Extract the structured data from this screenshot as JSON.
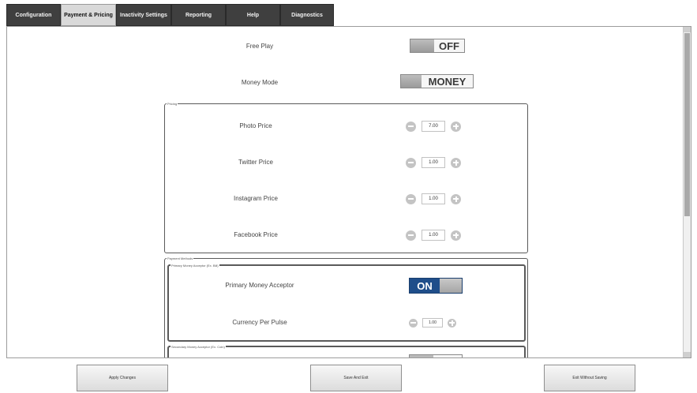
{
  "tabs": [
    {
      "label": "Configuration",
      "active": false
    },
    {
      "label": "Payment & Pricing",
      "active": true
    },
    {
      "label": "Inactivity Settings",
      "active": false
    },
    {
      "label": "Reporting",
      "active": false
    },
    {
      "label": "Help",
      "active": false
    },
    {
      "label": "Diagnostics",
      "active": false
    }
  ],
  "settings": {
    "free_play": {
      "label": "Free Play",
      "value": "OFF"
    },
    "money_mode": {
      "label": "Money Mode",
      "value": "MONEY"
    }
  },
  "pricing": {
    "legend": "Pricing",
    "items": [
      {
        "label": "Photo Price",
        "value": "7.00"
      },
      {
        "label": "Twitter Price",
        "value": "1.00"
      },
      {
        "label": "Instagram Price",
        "value": "1.00"
      },
      {
        "label": "Facebook Price",
        "value": "1.00"
      }
    ]
  },
  "payment_methods": {
    "legend": "Payment Methods",
    "primary": {
      "legend": "Primary Money Acceptor (Ex. Bill)",
      "acceptor_label": "Primary Money Acceptor",
      "acceptor_value": "ON",
      "pulse_label": "Currency Per Pulse",
      "pulse_value": "1.00"
    },
    "secondary": {
      "legend": "Secondary Money Acceptor (Ex. Coin)"
    }
  },
  "buttons": {
    "apply": "Apply Changes",
    "save_exit": "Save And Exit",
    "exit_no_save": "Exit Without Saving"
  },
  "colors": {
    "tab_bg": "#3f3f3f",
    "tab_active_bg": "#d9d9d9",
    "toggle_on": "#1f4e8a"
  }
}
